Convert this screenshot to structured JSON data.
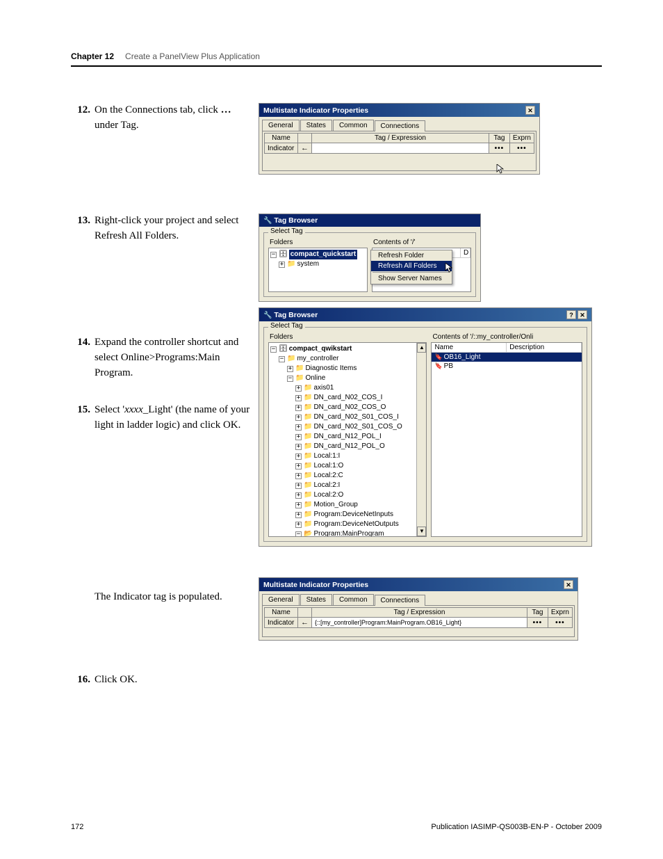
{
  "header": {
    "chapter": "Chapter 12",
    "title": "Create a PanelView Plus Application"
  },
  "steps": {
    "s12": {
      "num": "12.",
      "text_a": "On the Connections tab, click ",
      "bold": "…",
      "text_b": " under Tag."
    },
    "s13": {
      "num": "13.",
      "text": "Right-click your project and select Refresh All Folders."
    },
    "s14": {
      "num": "14.",
      "text": "Expand the controller shortcut and select Online>Programs:Main Program."
    },
    "s15": {
      "num": "15.",
      "text_a": "Select '",
      "italic": "xxxx",
      "text_b": "_Light' (the name of your light in ladder logic) and click OK."
    },
    "note": {
      "text": "The Indicator tag is populated."
    },
    "s16": {
      "num": "16.",
      "text": "Click OK."
    }
  },
  "dialog1": {
    "title": "Multistate Indicator Properties",
    "tabs": [
      "General",
      "States",
      "Common",
      "Connections"
    ],
    "cols": {
      "name": "Name",
      "tagexpr": "Tag / Expression",
      "tag": "Tag",
      "exprn": "Exprn"
    },
    "row_label": "Indicator",
    "dots": "•••"
  },
  "tb1": {
    "title": "Tag Browser",
    "group": "Select Tag",
    "folders_label": "Folders",
    "contents_label": "Contents of '/'",
    "root": "compact_quickstart",
    "system": "system",
    "name_col": "Name",
    "d_col": "D",
    "menu": [
      "Refresh Folder",
      "Refresh All Folders",
      "Show Server Names"
    ]
  },
  "tb2": {
    "title": "Tag Browser",
    "group": "Select Tag",
    "folders_label": "Folders",
    "contents_label": "Contents of '/::my_controller/Onli",
    "list_cols": {
      "name": "Name",
      "desc": "Description"
    },
    "list_items": [
      "OB16_Light",
      "PB"
    ],
    "tree": {
      "root": "compact_qwikstart",
      "ctrl": "my_controller",
      "diag": "Diagnostic Items",
      "online": "Online",
      "items": [
        "axis01",
        "DN_card_N02_COS_I",
        "DN_card_N02_COS_O",
        "DN_card_N02_S01_COS_I",
        "DN_card_N02_S01_COS_O",
        "DN_card_N12_POL_I",
        "DN_card_N12_POL_O",
        "Local:1:I",
        "Local:1:O",
        "Local:2:C",
        "Local:2:I",
        "Local:2:O",
        "Motion_Group",
        "Program:DeviceNetInputs",
        "Program:DeviceNetOutputs"
      ],
      "main": "Program:MainProgram"
    }
  },
  "dialog2": {
    "title": "Multistate Indicator Properties",
    "tabs": [
      "General",
      "States",
      "Common",
      "Connections"
    ],
    "cols": {
      "name": "Name",
      "tagexpr": "Tag / Expression",
      "tag": "Tag",
      "exprn": "Exprn"
    },
    "row_label": "Indicator",
    "tagval": "{::[my_controller]Program:MainProgram.OB16_Light}",
    "dots": "•••"
  },
  "footer": {
    "page": "172",
    "pub": "Publication IASIMP-QS003B-EN-P - October 2009"
  }
}
